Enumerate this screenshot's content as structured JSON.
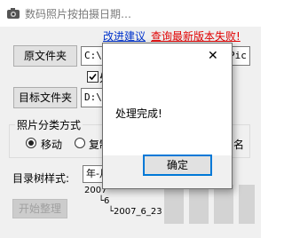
{
  "window": {
    "title": "数码照片按拍摄日期…",
    "links": {
      "suggest": "改进建议",
      "update_fail": "查询最新版本失败!"
    }
  },
  "source": {
    "button": "原文件夹",
    "path": "C:\\U",
    "path_tail": "Pic"
  },
  "process_check": {
    "label": "处"
  },
  "target": {
    "button": "目标文件夹",
    "path": "D:\\t"
  },
  "classify": {
    "group_label": "照片分类方式",
    "move_label": "移动",
    "copy_label": "复制",
    "name_tail": "名"
  },
  "tree_style": {
    "label": "目录树样式:",
    "value": "年-月",
    "preview": [
      "2007",
      "└6",
      "└2007_6_23"
    ]
  },
  "start_button": "开始整理",
  "dialog": {
    "message": "处理完成!",
    "ok_label": "确定",
    "close_glyph": "✕"
  },
  "colors": {
    "accent": "#0078d7",
    "link_blue": "#0033cc",
    "link_red": "#e00000"
  }
}
